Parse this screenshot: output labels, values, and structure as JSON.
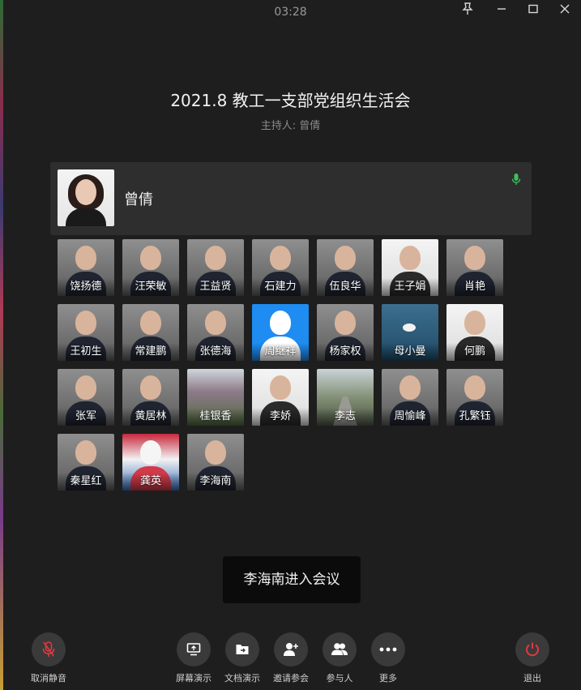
{
  "timer": "03:28",
  "meeting": {
    "title": "2021.8 教工一支部党组织生活会",
    "host_line": "主持人: 曾倩"
  },
  "active_speaker": {
    "name": "曾倩",
    "mic_icon": "mic-active-icon",
    "mic_color": "#3cc25a"
  },
  "participants": [
    "饶扬德",
    "汪荣敏",
    "王益贤",
    "石建力",
    "伍良华",
    "王子娟",
    "肖艳",
    "王初生",
    "常建鹏",
    "张德海",
    "周继祥",
    "杨家权",
    "母小曼",
    "何鹏",
    "张军",
    "黄居林",
    "桂银香",
    "李娇",
    "李志",
    "周愉峰",
    "孔繁钰",
    "秦星红",
    "龚英",
    "李海南"
  ],
  "toast": "李海南进入会议",
  "toolbar": {
    "unmute": "取消静音",
    "screen_share": "屏幕演示",
    "doc_share": "文档演示",
    "invite": "邀请参会",
    "participants": "参与人",
    "more": "更多",
    "leave": "退出"
  },
  "colors": {
    "background": "#1e1e1e",
    "leave_red": "#e0393e",
    "mic_muted_red": "#e0393e"
  }
}
